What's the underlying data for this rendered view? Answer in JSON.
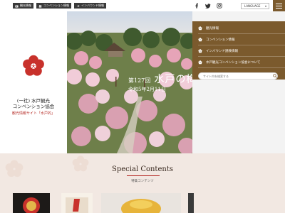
{
  "topbar": {
    "links": [
      {
        "label": "観光情報"
      },
      {
        "label": "コンベンション情報"
      },
      {
        "label": "インバウンド情報"
      }
    ],
    "language_label": "LANGUAGE"
  },
  "logo": {
    "org_name_line1": "(一社) 水戸観光",
    "org_name_line2": "コンベンション協会",
    "subtitle": "観光情報サイト「水戸的」"
  },
  "hero": {
    "edition": "第127回",
    "title": "水戸の梅",
    "date": "令和5年2月11日"
  },
  "nav": {
    "items": [
      {
        "label": "観光情報"
      },
      {
        "label": "コンベンション情報"
      },
      {
        "label": "インバウンド誘致情報"
      },
      {
        "label": "水戸観光コンベンション協会について"
      }
    ],
    "search_placeholder": "サイト内を検索する"
  },
  "special": {
    "title": "Special Contents",
    "subtitle": "特集コンテンツ"
  },
  "colors": {
    "brown": "#7b5a2d",
    "plum_red": "#c8312b"
  }
}
